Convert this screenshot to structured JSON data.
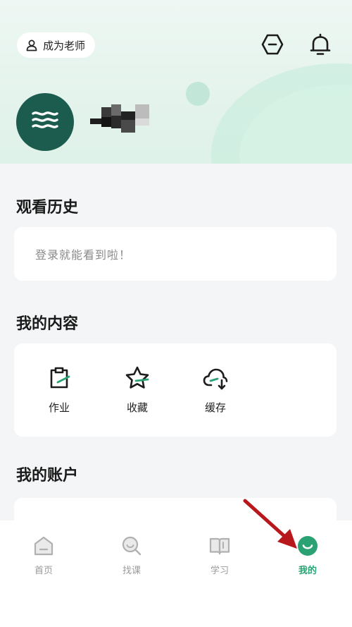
{
  "header": {
    "teacher_button": "成为老师",
    "username_obscured": true
  },
  "history": {
    "title": "观看历史",
    "empty_text": "登录就能看到啦！"
  },
  "my_content": {
    "title": "我的内容",
    "items": [
      {
        "label": "作业",
        "icon": "homework-icon"
      },
      {
        "label": "收藏",
        "icon": "favorites-star-icon"
      },
      {
        "label": "缓存",
        "icon": "download-cloud-icon"
      }
    ]
  },
  "account": {
    "title": "我的账户"
  },
  "tabbar": {
    "tabs": [
      {
        "label": "首页",
        "icon": "home-icon",
        "active": false
      },
      {
        "label": "找课",
        "icon": "search-course-icon",
        "active": false
      },
      {
        "label": "学习",
        "icon": "book-icon",
        "active": false
      },
      {
        "label": "我的",
        "icon": "profile-smile-icon",
        "active": true
      }
    ]
  },
  "colors": {
    "accent": "#2aa274",
    "avatar_bg": "#1c5c4f",
    "header_bg": "#e6f4ee",
    "annotation_arrow": "#b8171c"
  }
}
